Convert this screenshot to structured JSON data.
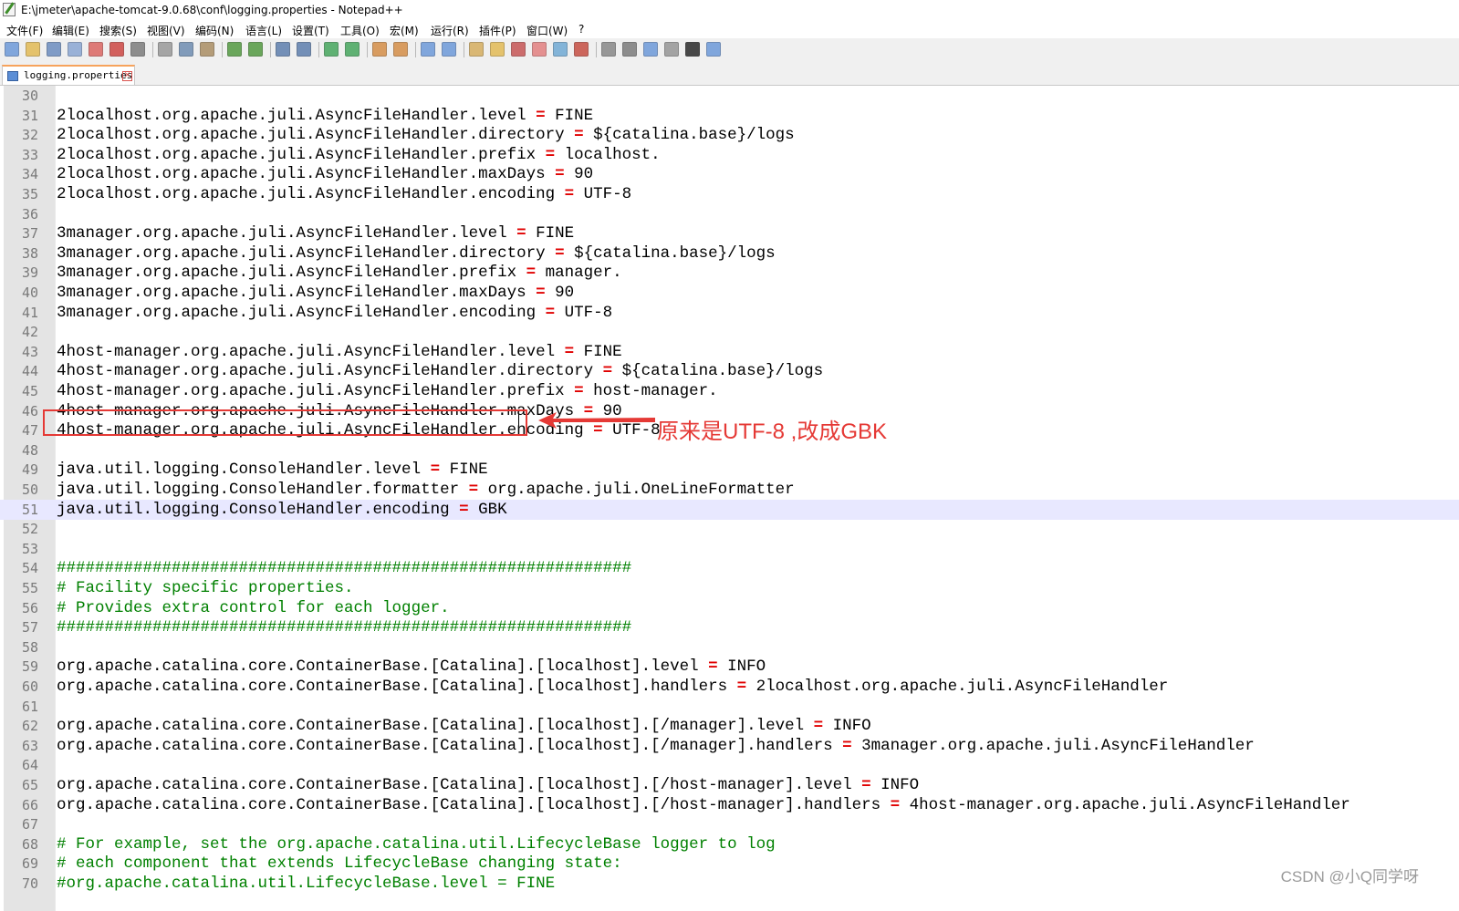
{
  "window": {
    "title": "E:\\jmeter\\apache-tomcat-9.0.68\\conf\\logging.properties - Notepad++"
  },
  "menu": [
    {
      "label": "文件(F)"
    },
    {
      "label": "编辑(E)"
    },
    {
      "label": "搜索(S)"
    },
    {
      "label": "视图(V)"
    },
    {
      "label": "编码(N)"
    },
    {
      "label": "语言(L)"
    },
    {
      "label": "设置(T)"
    },
    {
      "label": "工具(O)"
    },
    {
      "label": "宏(M)"
    },
    {
      "label": "运行(R)"
    },
    {
      "label": "插件(P)"
    },
    {
      "label": "窗口(W)"
    },
    {
      "label": "?"
    }
  ],
  "toolbar_icons": [
    "new-file-icon",
    "open-file-icon",
    "save-icon",
    "save-all-icon",
    "close-icon",
    "close-all-icon",
    "print-icon",
    "cut-icon",
    "copy-icon",
    "paste-icon",
    "undo-icon",
    "redo-icon",
    "find-icon",
    "replace-icon",
    "zoom-in-icon",
    "zoom-out-icon",
    "sync-vertical-icon",
    "sync-horizontal-icon",
    "word-wrap-icon",
    "show-all-chars-icon",
    "indent-guide-icon",
    "udl-icon",
    "doc-map-icon",
    "function-list-icon",
    "folder-workspace-icon",
    "monitor-icon",
    "record-macro-icon",
    "stop-record-icon",
    "playback-macro-icon",
    "run-macro-multiple-icon",
    "save-macro-icon",
    "jstool-icon"
  ],
  "tab": {
    "label": "logging.properties"
  },
  "editor": {
    "lines": [
      {
        "n": "30",
        "segs": []
      },
      {
        "n": "31",
        "segs": [
          {
            "t": "2localhost.org.apache.juli.AsyncFileHandler.level "
          },
          {
            "t": "=",
            "c": "op"
          },
          {
            "t": " FINE"
          }
        ]
      },
      {
        "n": "32",
        "segs": [
          {
            "t": "2localhost.org.apache.juli.AsyncFileHandler.directory "
          },
          {
            "t": "=",
            "c": "op"
          },
          {
            "t": " ${catalina.base}/logs"
          }
        ]
      },
      {
        "n": "33",
        "segs": [
          {
            "t": "2localhost.org.apache.juli.AsyncFileHandler.prefix "
          },
          {
            "t": "=",
            "c": "op"
          },
          {
            "t": " localhost."
          }
        ]
      },
      {
        "n": "34",
        "segs": [
          {
            "t": "2localhost.org.apache.juli.AsyncFileHandler.maxDays "
          },
          {
            "t": "=",
            "c": "op"
          },
          {
            "t": " 90"
          }
        ]
      },
      {
        "n": "35",
        "segs": [
          {
            "t": "2localhost.org.apache.juli.AsyncFileHandler.encoding "
          },
          {
            "t": "=",
            "c": "op"
          },
          {
            "t": " UTF-8"
          }
        ]
      },
      {
        "n": "36",
        "segs": []
      },
      {
        "n": "37",
        "segs": [
          {
            "t": "3manager.org.apache.juli.AsyncFileHandler.level "
          },
          {
            "t": "=",
            "c": "op"
          },
          {
            "t": " FINE"
          }
        ]
      },
      {
        "n": "38",
        "segs": [
          {
            "t": "3manager.org.apache.juli.AsyncFileHandler.directory "
          },
          {
            "t": "=",
            "c": "op"
          },
          {
            "t": " ${catalina.base}/logs"
          }
        ]
      },
      {
        "n": "39",
        "segs": [
          {
            "t": "3manager.org.apache.juli.AsyncFileHandler.prefix "
          },
          {
            "t": "=",
            "c": "op"
          },
          {
            "t": " manager."
          }
        ]
      },
      {
        "n": "40",
        "segs": [
          {
            "t": "3manager.org.apache.juli.AsyncFileHandler.maxDays "
          },
          {
            "t": "=",
            "c": "op"
          },
          {
            "t": " 90"
          }
        ]
      },
      {
        "n": "41",
        "segs": [
          {
            "t": "3manager.org.apache.juli.AsyncFileHandler.encoding "
          },
          {
            "t": "=",
            "c": "op"
          },
          {
            "t": " UTF-8"
          }
        ]
      },
      {
        "n": "42",
        "segs": []
      },
      {
        "n": "43",
        "segs": [
          {
            "t": "4host-manager.org.apache.juli.AsyncFileHandler.level "
          },
          {
            "t": "=",
            "c": "op"
          },
          {
            "t": " FINE"
          }
        ]
      },
      {
        "n": "44",
        "segs": [
          {
            "t": "4host-manager.org.apache.juli.AsyncFileHandler.directory "
          },
          {
            "t": "=",
            "c": "op"
          },
          {
            "t": " ${catalina.base}/logs"
          }
        ]
      },
      {
        "n": "45",
        "segs": [
          {
            "t": "4host-manager.org.apache.juli.AsyncFileHandler.prefix "
          },
          {
            "t": "=",
            "c": "op"
          },
          {
            "t": " host-manager."
          }
        ]
      },
      {
        "n": "46",
        "segs": [
          {
            "t": "4host-manager.org.apache.juli.AsyncFileHandler.maxDays "
          },
          {
            "t": "=",
            "c": "op"
          },
          {
            "t": " 90"
          }
        ]
      },
      {
        "n": "47",
        "segs": [
          {
            "t": "4host-manager.org.apache.juli.AsyncFileHandler.encoding "
          },
          {
            "t": "=",
            "c": "op"
          },
          {
            "t": " UTF-8"
          }
        ]
      },
      {
        "n": "48",
        "segs": []
      },
      {
        "n": "49",
        "segs": [
          {
            "t": "java.util.logging.ConsoleHandler.level "
          },
          {
            "t": "=",
            "c": "op"
          },
          {
            "t": " FINE"
          }
        ]
      },
      {
        "n": "50",
        "segs": [
          {
            "t": "java.util.logging.ConsoleHandler.formatter "
          },
          {
            "t": "=",
            "c": "op"
          },
          {
            "t": " org.apache.juli.OneLineFormatter"
          }
        ]
      },
      {
        "n": "51",
        "current": true,
        "segs": [
          {
            "t": "java.util.logging.ConsoleHandler.encoding "
          },
          {
            "t": "=",
            "c": "op"
          },
          {
            "t": " GBK"
          }
        ]
      },
      {
        "n": "52",
        "segs": []
      },
      {
        "n": "53",
        "segs": []
      },
      {
        "n": "54",
        "segs": [
          {
            "t": "############################################################",
            "c": "cmt"
          }
        ]
      },
      {
        "n": "55",
        "segs": [
          {
            "t": "# Facility specific properties.",
            "c": "cmt"
          }
        ]
      },
      {
        "n": "56",
        "segs": [
          {
            "t": "# Provides extra control for each logger.",
            "c": "cmt"
          }
        ]
      },
      {
        "n": "57",
        "segs": [
          {
            "t": "############################################################",
            "c": "cmt"
          }
        ]
      },
      {
        "n": "58",
        "segs": []
      },
      {
        "n": "59",
        "segs": [
          {
            "t": "org.apache.catalina.core.ContainerBase.[Catalina].[localhost].level "
          },
          {
            "t": "=",
            "c": "op"
          },
          {
            "t": " INFO"
          }
        ]
      },
      {
        "n": "60",
        "segs": [
          {
            "t": "org.apache.catalina.core.ContainerBase.[Catalina].[localhost].handlers "
          },
          {
            "t": "=",
            "c": "op"
          },
          {
            "t": " 2localhost.org.apache.juli.AsyncFileHandler"
          }
        ]
      },
      {
        "n": "61",
        "segs": []
      },
      {
        "n": "62",
        "segs": [
          {
            "t": "org.apache.catalina.core.ContainerBase.[Catalina].[localhost].[/manager].level "
          },
          {
            "t": "=",
            "c": "op"
          },
          {
            "t": " INFO"
          }
        ]
      },
      {
        "n": "63",
        "segs": [
          {
            "t": "org.apache.catalina.core.ContainerBase.[Catalina].[localhost].[/manager].handlers "
          },
          {
            "t": "=",
            "c": "op"
          },
          {
            "t": " 3manager.org.apache.juli.AsyncFileHandler"
          }
        ]
      },
      {
        "n": "64",
        "segs": []
      },
      {
        "n": "65",
        "segs": [
          {
            "t": "org.apache.catalina.core.ContainerBase.[Catalina].[localhost].[/host-manager].level "
          },
          {
            "t": "=",
            "c": "op"
          },
          {
            "t": " INFO"
          }
        ]
      },
      {
        "n": "66",
        "segs": [
          {
            "t": "org.apache.catalina.core.ContainerBase.[Catalina].[localhost].[/host-manager].handlers "
          },
          {
            "t": "=",
            "c": "op"
          },
          {
            "t": " 4host-manager.org.apache.juli.AsyncFileHandler"
          }
        ]
      },
      {
        "n": "67",
        "segs": []
      },
      {
        "n": "68",
        "segs": [
          {
            "t": "# For example, set the org.apache.catalina.util.LifecycleBase logger to log",
            "c": "cmt"
          }
        ]
      },
      {
        "n": "69",
        "segs": [
          {
            "t": "# each component that extends LifecycleBase changing state:",
            "c": "cmt"
          }
        ]
      },
      {
        "n": "70",
        "segs": [
          {
            "t": "#org.apache.catalina.util.LifecycleBase.level = FINE",
            "c": "cmt"
          }
        ]
      }
    ]
  },
  "annotation": {
    "text": "原来是UTF-8 ,改成GBK",
    "color": "#e53935"
  },
  "watermark": "CSDN @小Q同学呀",
  "colors": {
    "operator": "#e00000",
    "comment": "#008000",
    "current_line": "#e8e8ff",
    "gutter": "#e4e4e4"
  }
}
